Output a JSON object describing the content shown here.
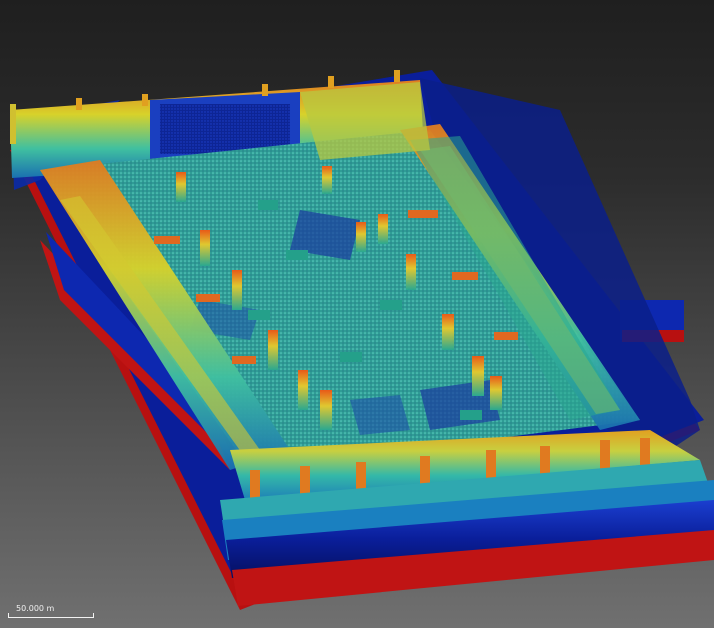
{
  "viewer": {
    "scale_label": "50.000 m"
  },
  "colors": {
    "background_top": "#1f1f1f",
    "background_bottom": "#707070",
    "ramp_low": "#c01010",
    "ramp_mid_low": "#0a2aa8",
    "ramp_mid": "#1aa7a0",
    "ramp_mid_high": "#d9d22a",
    "ramp_high": "#e06020",
    "scale_bar": "#f2f2f2"
  }
}
